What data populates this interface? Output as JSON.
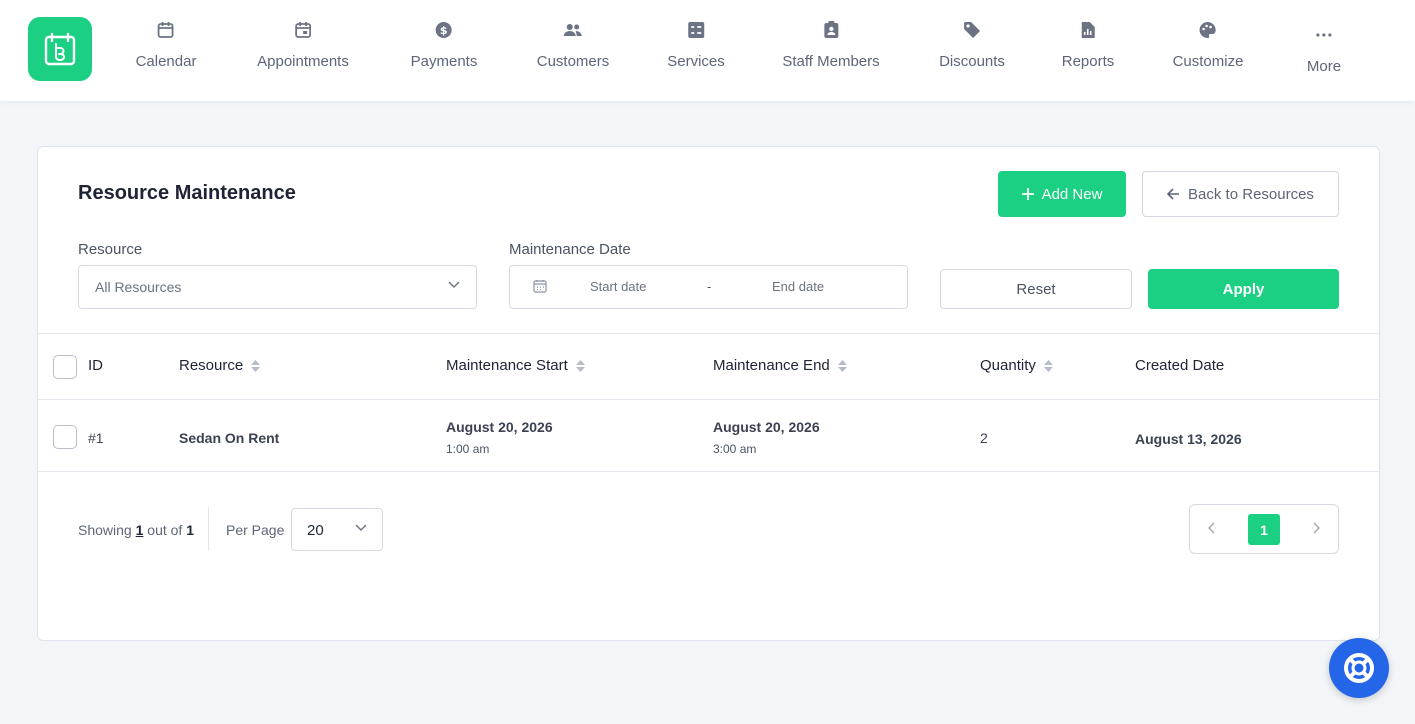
{
  "colors": {
    "accent": "#1bd083",
    "help": "#2565e8",
    "nav_icon": "#6b7385"
  },
  "nav": {
    "logo_icon": "calendar-logo-icon",
    "items": [
      {
        "label": "Calendar",
        "icon": "calendar-icon"
      },
      {
        "label": "Appointments",
        "icon": "calendar-event-icon"
      },
      {
        "label": "Payments",
        "icon": "dollar-icon"
      },
      {
        "label": "Customers",
        "icon": "users-icon"
      },
      {
        "label": "Services",
        "icon": "services-list-icon"
      },
      {
        "label": "Staff Members",
        "icon": "staff-badge-icon"
      },
      {
        "label": "Discounts",
        "icon": "tag-icon"
      },
      {
        "label": "Reports",
        "icon": "report-icon"
      },
      {
        "label": "Customize",
        "icon": "palette-icon"
      },
      {
        "label": "More",
        "icon": "more-dots-icon"
      }
    ]
  },
  "page": {
    "title": "Resource Maintenance",
    "add_new_label": "Add New",
    "back_label": "Back to Resources"
  },
  "filters": {
    "resource_label": "Resource",
    "resource_value": "All Resources",
    "date_label": "Maintenance Date",
    "start_placeholder": "Start date",
    "separator": "-",
    "end_placeholder": "End date",
    "reset_label": "Reset",
    "apply_label": "Apply"
  },
  "table": {
    "headers": {
      "id": "ID",
      "resource": "Resource",
      "start": "Maintenance Start",
      "end": "Maintenance End",
      "quantity": "Quantity",
      "created": "Created Date"
    },
    "rows": [
      {
        "id": "#1",
        "resource": "Sedan On Rent",
        "start_date": "August 20, 2026",
        "start_time": "1:00 am",
        "end_date": "August 20, 2026",
        "end_time": "3:00 am",
        "quantity": "2",
        "created": "August 13, 2026"
      }
    ]
  },
  "footer": {
    "showing_prefix": "Showing",
    "showing_current": "1",
    "showing_middle": "out of",
    "showing_total": "1",
    "per_page_label": "Per Page",
    "per_page_value": "20",
    "current_page": "1"
  }
}
